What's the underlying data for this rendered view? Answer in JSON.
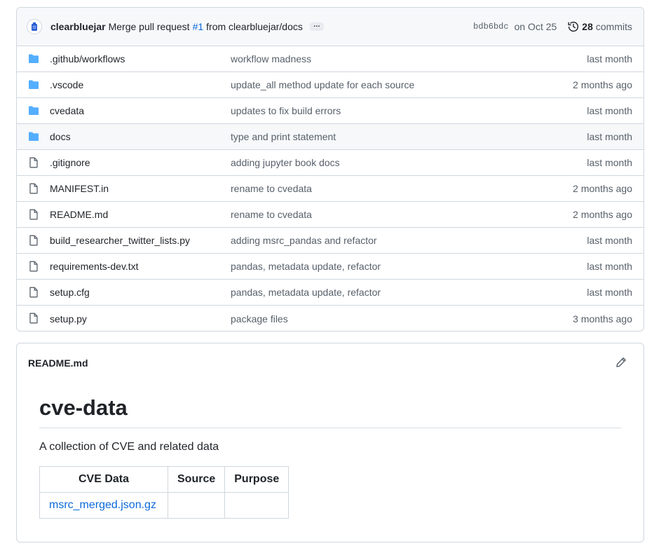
{
  "commit": {
    "author": "clearbluejar",
    "message_prefix": "Merge pull request",
    "pr_link": "#1",
    "message_suffix": "from clearbluejar/docs",
    "ellipsis": "…",
    "sha": "bdb6bdc",
    "date": "on Oct 25",
    "commit_count": "28",
    "commits_label": "commits"
  },
  "files": [
    {
      "type": "folder",
      "name": ".github/workflows",
      "message": "workflow madness",
      "age": "last month"
    },
    {
      "type": "folder",
      "name": ".vscode",
      "message": "update_all method update for each source",
      "age": "2 months ago"
    },
    {
      "type": "folder",
      "name": "cvedata",
      "message": "updates to fix build errors",
      "age": "last month"
    },
    {
      "type": "folder",
      "name": "docs",
      "message": "type and print statement",
      "age": "last month"
    },
    {
      "type": "file",
      "name": ".gitignore",
      "message": "adding jupyter book docs",
      "age": "last month"
    },
    {
      "type": "file",
      "name": "MANIFEST.in",
      "message": "rename to cvedata",
      "age": "2 months ago"
    },
    {
      "type": "file",
      "name": "README.md",
      "message": "rename to cvedata",
      "age": "2 months ago"
    },
    {
      "type": "file",
      "name": "build_researcher_twitter_lists.py",
      "message": "adding msrc_pandas and refactor",
      "age": "last month"
    },
    {
      "type": "file",
      "name": "requirements-dev.txt",
      "message": "pandas, metadata update, refactor",
      "age": "last month"
    },
    {
      "type": "file",
      "name": "setup.cfg",
      "message": "pandas, metadata update, refactor",
      "age": "last month"
    },
    {
      "type": "file",
      "name": "setup.py",
      "message": "package files",
      "age": "3 months ago"
    }
  ],
  "readme": {
    "filename": "README.md",
    "heading": "cve-data",
    "paragraph": "A collection of CVE and related data",
    "table": {
      "headers": [
        "CVE Data",
        "Source",
        "Purpose"
      ],
      "rows": [
        [
          "msrc_merged.json.gz",
          "",
          ""
        ]
      ]
    }
  },
  "colors": {
    "folder": "#54aeff",
    "link": "#0969da",
    "muted": "#57606a"
  }
}
